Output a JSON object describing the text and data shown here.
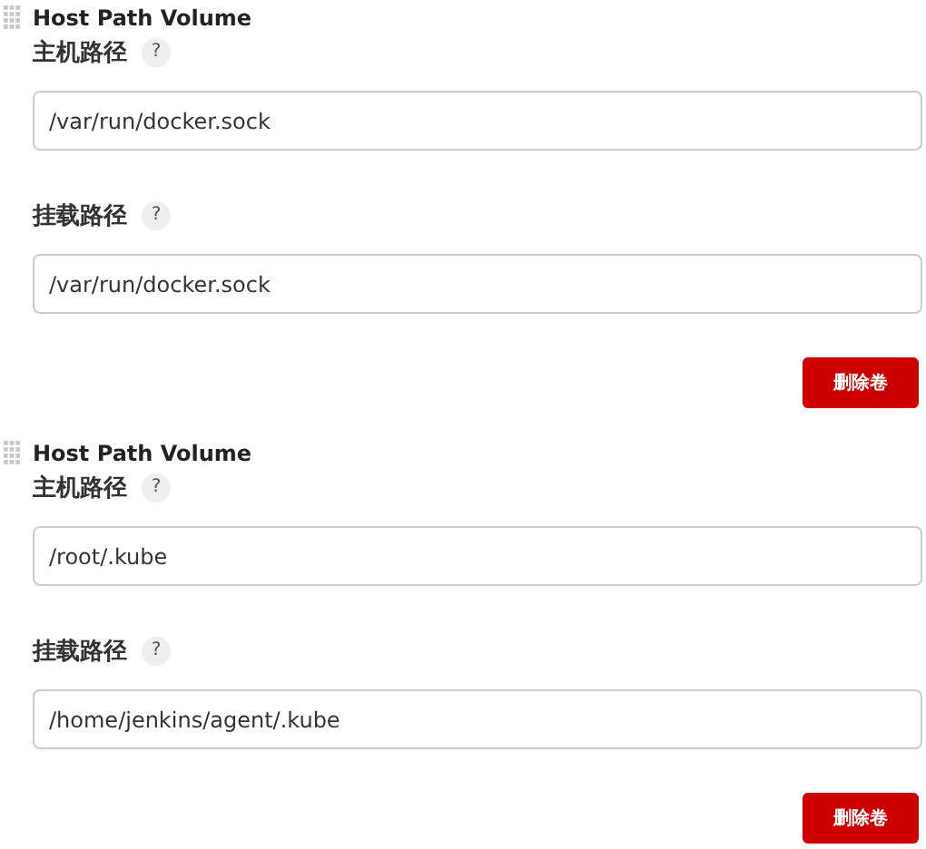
{
  "volumes": [
    {
      "title": "Host Path Volume",
      "fields": [
        {
          "label": "主机路径",
          "help": "?",
          "value": "/var/run/docker.sock"
        },
        {
          "label": "挂载路径",
          "help": "?",
          "value": "/var/run/docker.sock"
        }
      ],
      "delete_button": "删除卷"
    },
    {
      "title": "Host Path Volume",
      "fields": [
        {
          "label": "主机路径",
          "help": "?",
          "value": "/root/.kube"
        },
        {
          "label": "挂载路径",
          "help": "?",
          "value": "/home/jenkins/agent/.kube"
        }
      ],
      "delete_button": "删除卷"
    }
  ]
}
